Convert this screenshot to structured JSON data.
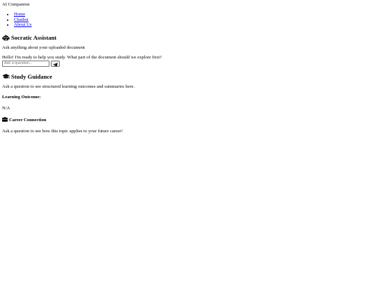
{
  "brand": "AI Companion",
  "nav": [
    {
      "label": "Home"
    },
    {
      "label": "Chatbot"
    },
    {
      "label": "About Us"
    }
  ],
  "assistant": {
    "title": "Socratic Assistant",
    "icon": "robot-icon",
    "description": "Ask anything about your uploaded document",
    "bot_message": "Hello! I'm ready to help you study. What part of the document should we explore first?",
    "input_placeholder": "Ask a question...",
    "input_value": "",
    "send_icon": "paper-plane-icon"
  },
  "guidance": {
    "title": "Study Guidance",
    "icon": "graduation-cap-icon",
    "description": "Ask a question to see structured learning outcomes and summaries here.",
    "outcome_label": "Learning Outcome:",
    "outcome_value": "N/A"
  },
  "career": {
    "title": "Career Connection",
    "icon": "briefcase-icon",
    "description": "Ask a question to see how this topic applies to your future career!"
  },
  "colors": {
    "link": "#0000ee",
    "text": "#000000",
    "background": "#ffffff"
  }
}
